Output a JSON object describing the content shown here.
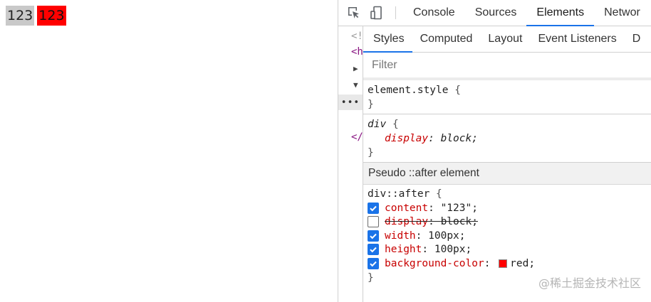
{
  "page": {
    "div_text": "123",
    "after_content": "123"
  },
  "colors": {
    "accent": "#1a73e8",
    "demo_text_bg": "#c9c9c9",
    "pseudo_after_bg": "#ff0000",
    "prop_name": "#c80000"
  },
  "devtools": {
    "toolbar": {
      "icons": [
        "inspect-element-icon",
        "device-toolbar-icon"
      ],
      "tabs": [
        "Console",
        "Sources",
        "Elements",
        "Networ"
      ],
      "active_tab": "Elements"
    },
    "dom_tree": {
      "lines": [
        "<!",
        "<h",
        "</"
      ],
      "dots": "•••"
    },
    "styles": {
      "subtabs": [
        "Styles",
        "Computed",
        "Layout",
        "Event Listeners",
        "D"
      ],
      "active_subtab": "Styles",
      "filter_placeholder": "Filter",
      "element_style": {
        "selector": "element.style",
        "open": "{",
        "close": "}"
      },
      "ua_rule": {
        "selector": "div",
        "open": "{",
        "prop": "display",
        "value": "block;",
        "close": "}"
      },
      "pseudo_header": "Pseudo ::after element",
      "after_rule": {
        "selector": "div::after",
        "open": "{",
        "close": "}",
        "declarations": [
          {
            "prop": "content",
            "value": "\"123\";",
            "checked": true
          },
          {
            "prop": "display",
            "value": "block;",
            "checked": false
          },
          {
            "prop": "width",
            "value": "100px;",
            "checked": true
          },
          {
            "prop": "height",
            "value": "100px;",
            "checked": true
          },
          {
            "prop": "background-color",
            "value": "red;",
            "checked": true,
            "swatch": "#ff0000"
          }
        ]
      }
    }
  },
  "watermark": "@稀土掘金技术社区"
}
